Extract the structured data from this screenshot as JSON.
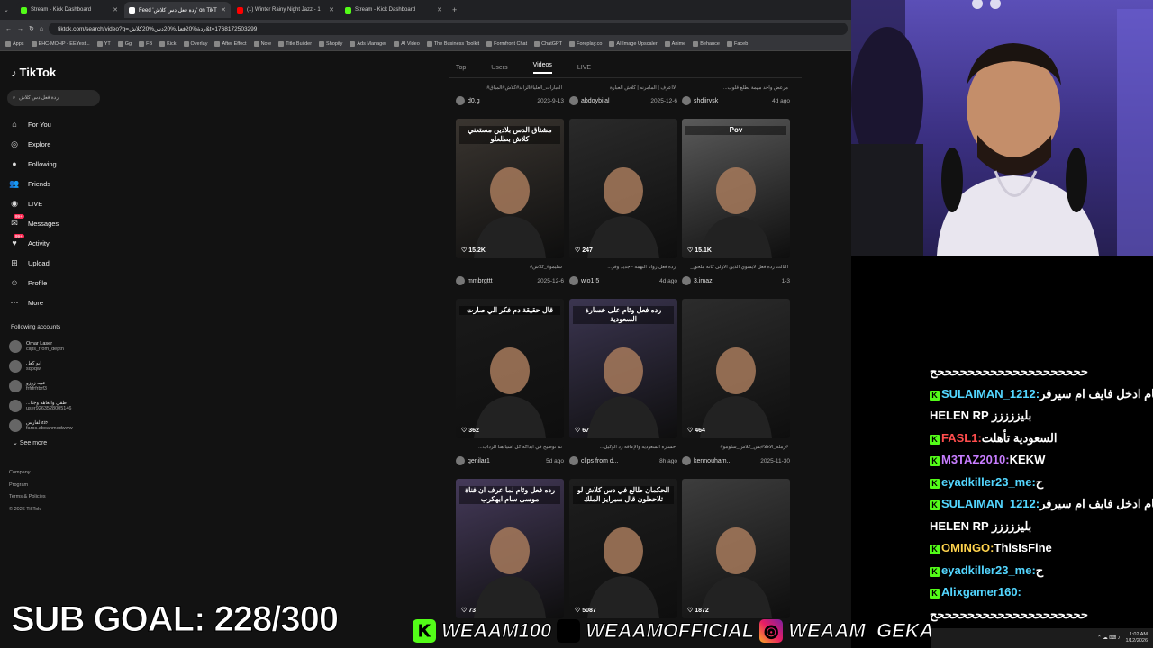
{
  "browser": {
    "tabs": [
      {
        "label": "Stream - Kick Dashboard",
        "color": "#53fc18"
      },
      {
        "label": "Feed 'ردة فعل دس كلاش' on TikT",
        "color": "#ffffff"
      },
      {
        "label": "(1) Winter Rainy Night Jazz - 1",
        "color": "#ff0000"
      },
      {
        "label": "Stream - Kick Dashboard",
        "color": "#53fc18"
      }
    ],
    "url": "tiktok.com/search/video?q=ردة%20فعل%20دس%20كلاش&t=1768172503299",
    "bookmarks": [
      "Apps",
      "EHC-MOHP - EEYest...",
      "YT",
      "Gg",
      "FB",
      "Kick",
      "Overlay",
      "After Effect",
      "Note",
      "Title Builder",
      "Shopify",
      "Ads Manager",
      "AI Video",
      "The Business Toolkit",
      "Formfront Chat",
      "ChatGPT",
      "Foreplay.co",
      "AI Image Upscaler",
      "Anime",
      "Behance",
      "Faceb"
    ]
  },
  "tiktok": {
    "logo": "TikTok",
    "search_value": "ردة فعل دس كلاش",
    "nav": [
      {
        "label": "For You",
        "icon": "home-icon"
      },
      {
        "label": "Explore",
        "icon": "compass-icon"
      },
      {
        "label": "Following",
        "icon": "avatar-icon"
      },
      {
        "label": "Friends",
        "icon": "friends-icon"
      },
      {
        "label": "LIVE",
        "icon": "live-icon"
      },
      {
        "label": "Messages",
        "icon": "messages-icon",
        "badge": "99+"
      },
      {
        "label": "Activity",
        "icon": "activity-icon",
        "badge": "99+"
      },
      {
        "label": "Upload",
        "icon": "upload-icon"
      },
      {
        "label": "Profile",
        "icon": "profile-icon"
      },
      {
        "label": "More",
        "icon": "more-icon"
      }
    ],
    "following_title": "Following accounts",
    "accounts": [
      {
        "name": "Omar Laser",
        "handle": "clips_from_depth"
      },
      {
        "name": "ابو كعل",
        "handle": "sqpqw"
      },
      {
        "name": "عبيه زوزو",
        "handle": "frfrfrfrbrf3"
      },
      {
        "name": "...طفي والعاهه وجنا",
        "handle": "user9263528005146"
      },
      {
        "name": "الفارس𝔞𝔯𝔬",
        "handle": "faros.aboahmedwww"
      }
    ],
    "see_more": "See more",
    "footer": [
      "Company",
      "Program",
      "Terms & Policies",
      "© 2026 TikTok"
    ],
    "result_tabs": [
      "Top",
      "Users",
      "Videos",
      "LIVE"
    ],
    "top_row": [
      {
        "caption": "#العبارات_العليا#الزاند#كلاش#المياق",
        "user": "d0.g",
        "date": "2023-9-13"
      },
      {
        "caption": "لااعرف | المامرنه | كلاش العبارة",
        "user": "abdoybilal",
        "date": "2025-12-6"
      },
      {
        "caption": "...مرعض واحد مهمة يطلع قلوب",
        "user": "shdiirvsk",
        "date": "4d ago"
      }
    ],
    "videos": [
      {
        "likes": "15.2K",
        "caption": "#سليمو#_كلاش",
        "user": "mmbrgttt",
        "date": "2025-12-6",
        "bg": "#3a3530",
        "overlay": "مشتاق الدس بلادين مستعني كلاش بطلعلو"
      },
      {
        "likes": "247",
        "caption": "...ردة فعل روانا التهمة - جديد وفر",
        "user": "wio1.5",
        "date": "4d ago",
        "bg": "#2a2a2a",
        "overlay": ""
      },
      {
        "likes": "15.1K",
        "caption": "_الثالث ردة فعل لايسوي الذين الأولى كأنه ملحق",
        "user": "3.imaz",
        "date": "1-3",
        "bg": "#5a5a5a",
        "overlay": "Pov"
      },
      {
        "likes": "362",
        "caption": "...تم توضيح في ابداكه كل اشيأ هنا الرداب",
        "user": "genilar1",
        "date": "5d ago",
        "bg": "#1a1a1a",
        "overlay": "قال حقيقة دم فكر الي صارت"
      },
      {
        "likes": "67",
        "caption": "...خسارة السعودية والإعاقة رد الوكيل",
        "user": "clips from d...",
        "date": "8h ago",
        "bg": "#3b3550",
        "overlay": "رده فعل وئام على خسارة السعودية"
      },
      {
        "likes": "464",
        "caption": "#رملة_الافلا#بس_كلاش_سلومو#",
        "user": "kennouham...",
        "date": "2025-11-30",
        "bg": "#2c2c2c",
        "overlay": ""
      },
      {
        "likes": "73",
        "caption": "",
        "user": "",
        "date": "",
        "bg": "#453a5a",
        "overlay": "رده فعل وئام لما عرف ان فناة موسى سام ابهكرب"
      },
      {
        "likes": "5087",
        "caption": "",
        "user": "",
        "date": "",
        "bg": "#1e1e1e",
        "overlay": "الحكمان طالع في دس كلاش لو تلاحظون قال سبرايز الملك"
      },
      {
        "likes": "1872",
        "caption": "",
        "user": "",
        "date": "",
        "bg": "#3d3d3d",
        "overlay": ""
      }
    ]
  },
  "chat": [
    {
      "user": "",
      "msg": "ححححححححححححححححححححح",
      "color": "#ffffff",
      "badge": false
    },
    {
      "user": "SULAIMAN_1212:",
      "msg": "نام ادخل فايف ام سيرفر",
      "color": "#53d6ff",
      "badge": true
    },
    {
      "user": "",
      "msg": "HELEN RP بليززززز",
      "color": "#ffffff",
      "badge": false
    },
    {
      "user": "FASL1:",
      "msg": "السعودية تأهلت",
      "color": "#ff4d4d",
      "badge": true
    },
    {
      "user": "M3TAZ2010:",
      "msg": "KEKW",
      "color": "#c77dff",
      "badge": true
    },
    {
      "user": "eyadkiller23_me:",
      "msg": "ح",
      "color": "#53d6ff",
      "badge": true
    },
    {
      "user": "SULAIMAN_1212:",
      "msg": "نام ادخل فايف ام سيرفر",
      "color": "#53d6ff",
      "badge": true
    },
    {
      "user": "",
      "msg": "HELEN RP بليززززز",
      "color": "#ffffff",
      "badge": false
    },
    {
      "user": "OMINGO:",
      "msg": "ThisIsFine",
      "color": "#ffd34d",
      "badge": true
    },
    {
      "user": "eyadkiller23_me:",
      "msg": "ح",
      "color": "#53d6ff",
      "badge": true
    },
    {
      "user": "Alixgamer160:",
      "msg": "",
      "color": "#53d6ff",
      "badge": true
    },
    {
      "user": "",
      "msg": "ححححححححححححححححححححح",
      "color": "#ffffff",
      "badge": false
    }
  ],
  "overlay": {
    "sub_goal": "SUB GOAL: 228/300",
    "kick": "WEAAM100",
    "x": "WEAAMOFFICIAL",
    "instagram": "WEAAM_GEKA"
  },
  "taskbar": {
    "time": "1:02 AM",
    "date": "1/12/2026"
  }
}
